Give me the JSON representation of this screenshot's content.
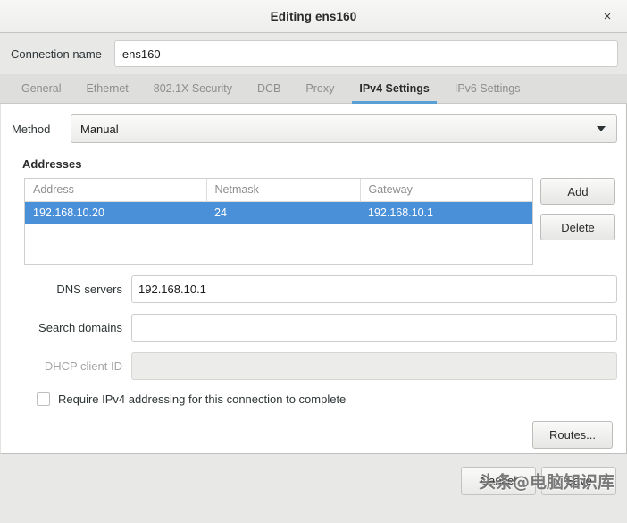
{
  "titlebar": {
    "title": "Editing ens160",
    "close_label": "×"
  },
  "connection": {
    "label": "Connection name",
    "value": "ens160",
    "placeholder": ""
  },
  "tabs": [
    {
      "label": "General",
      "active": false
    },
    {
      "label": "Ethernet",
      "active": false
    },
    {
      "label": "802.1X Security",
      "active": false
    },
    {
      "label": "DCB",
      "active": false
    },
    {
      "label": "Proxy",
      "active": false
    },
    {
      "label": "IPv4 Settings",
      "active": true
    },
    {
      "label": "IPv6 Settings",
      "active": false
    }
  ],
  "ipv4": {
    "method_label": "Method",
    "method_value": "Manual",
    "addresses_title": "Addresses",
    "table": {
      "columns": [
        "Address",
        "Netmask",
        "Gateway"
      ],
      "rows": [
        {
          "address": "192.168.10.20",
          "netmask": "24",
          "gateway": "192.168.10.1",
          "selected": true
        }
      ]
    },
    "add_label": "Add",
    "delete_label": "Delete",
    "dns_label": "DNS servers",
    "dns_value": "192.168.10.1",
    "search_label": "Search domains",
    "search_value": "",
    "dhcp_label": "DHCP client ID",
    "dhcp_value": "",
    "require_label": "Require IPv4 addressing for this connection to complete",
    "require_checked": false,
    "routes_label": "Routes..."
  },
  "footer": {
    "cancel_label": "Cancel",
    "save_label": "Save",
    "watermark": "头条@电脑知识库"
  },
  "colors": {
    "selection_blue": "#4a90d9",
    "tab_underline": "#5a9fd4",
    "window_bg": "#e8e8e7",
    "content_bg": "#ffffff"
  }
}
